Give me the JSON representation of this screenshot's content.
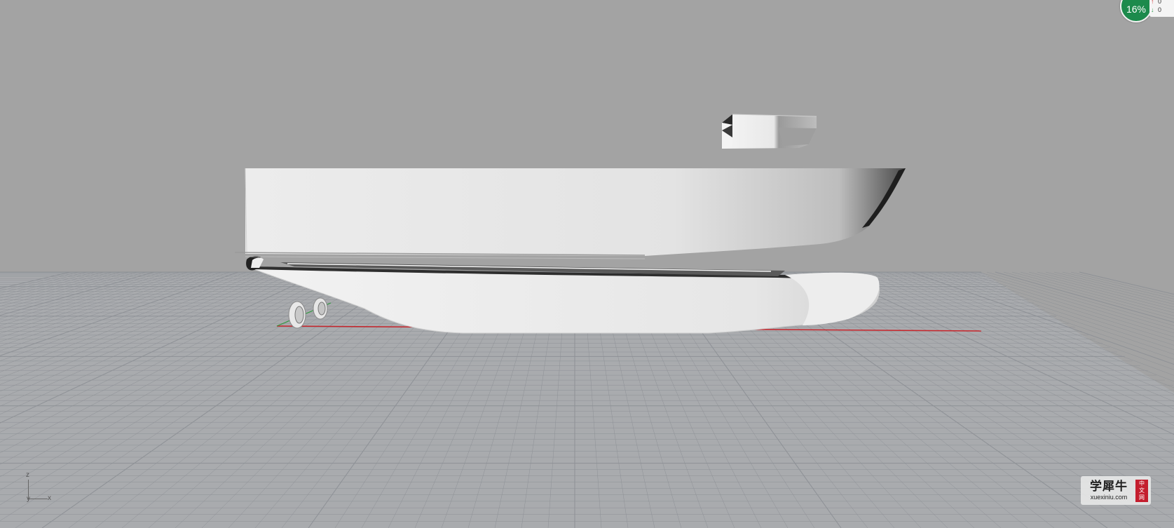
{
  "viewport": {
    "background_color": "#a3a3a3",
    "grid_color": "#8e9196",
    "x_axis_color": "#c8252b",
    "y_axis_color": "#2e9a3c"
  },
  "axis_widget": {
    "z_label": "z",
    "y_label": "y",
    "x_label": "x"
  },
  "progress_badge": {
    "value": "16%",
    "color": "#1c8a4c"
  },
  "net_speed": {
    "up_icon": "arrow-up-icon",
    "down_icon": "arrow-down-icon",
    "up_value": "0",
    "down_value": "0"
  },
  "watermark": {
    "name": "学犀牛",
    "site": "xuexiniu.com",
    "seal_chars": [
      "中",
      "文",
      "网"
    ],
    "seal_color": "#c41e2e"
  }
}
